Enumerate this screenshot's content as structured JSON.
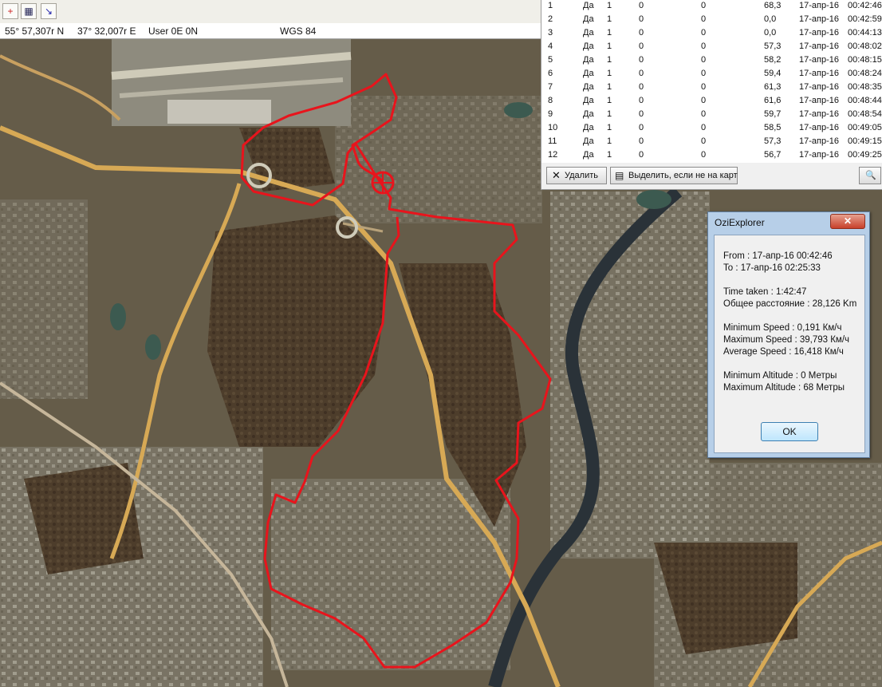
{
  "toolbar": {
    "icons": [
      "crosshair-add-icon",
      "map-grid-icon",
      "track-line-icon"
    ]
  },
  "status": {
    "lat": "55° 57,307r N",
    "lon": "37° 32,007r E",
    "user_grid": "User 0E  0N",
    "datum": "WGS 84"
  },
  "track_table": {
    "rows": [
      [
        "1",
        "Да",
        "1",
        "0",
        "0",
        "68,3",
        "17-апр-16",
        "00:42:46"
      ],
      [
        "2",
        "Да",
        "1",
        "0",
        "0",
        "0,0",
        "17-апр-16",
        "00:42:59"
      ],
      [
        "3",
        "Да",
        "1",
        "0",
        "0",
        "0,0",
        "17-апр-16",
        "00:44:13"
      ],
      [
        "4",
        "Да",
        "1",
        "0",
        "0",
        "57,3",
        "17-апр-16",
        "00:48:02"
      ],
      [
        "5",
        "Да",
        "1",
        "0",
        "0",
        "58,2",
        "17-апр-16",
        "00:48:15"
      ],
      [
        "6",
        "Да",
        "1",
        "0",
        "0",
        "59,4",
        "17-апр-16",
        "00:48:24"
      ],
      [
        "7",
        "Да",
        "1",
        "0",
        "0",
        "61,3",
        "17-апр-16",
        "00:48:35"
      ],
      [
        "8",
        "Да",
        "1",
        "0",
        "0",
        "61,6",
        "17-апр-16",
        "00:48:44"
      ],
      [
        "9",
        "Да",
        "1",
        "0",
        "0",
        "59,7",
        "17-апр-16",
        "00:48:54"
      ],
      [
        "10",
        "Да",
        "1",
        "0",
        "0",
        "58,5",
        "17-апр-16",
        "00:49:05"
      ],
      [
        "11",
        "Да",
        "1",
        "0",
        "0",
        "57,3",
        "17-апр-16",
        "00:49:15"
      ],
      [
        "12",
        "Да",
        "1",
        "0",
        "0",
        "56,7",
        "17-апр-16",
        "00:49:25"
      ]
    ],
    "delete_label": "Удалить",
    "select_label": "Выделить, если не на карт"
  },
  "dialog": {
    "title": "OziExplorer",
    "from": "From : 17-апр-16 00:42:46",
    "to": "To : 17-апр-16 02:25:33",
    "time_taken": "Time taken : 1:42:47",
    "distance": "Общее расстояние : 28,126 Km",
    "min_speed": "Minimum Speed : 0,191 Км/ч",
    "max_speed": "Maximum Speed : 39,793 Км/ч",
    "avg_speed": "Average Speed : 16,418 Км/ч",
    "min_alt": "Minimum Altitude : 0 Метры",
    "max_alt": "Maximum Altitude : 68 Метры",
    "ok_label": "OK",
    "close_glyph": "✕"
  },
  "colors": {
    "track": "#e8141c",
    "river": "#2a3238",
    "road": "#d7a955",
    "forest": "#4a3a28"
  }
}
